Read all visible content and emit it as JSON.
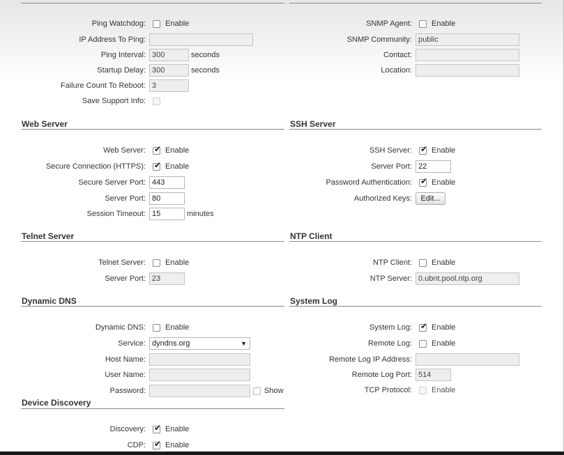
{
  "watchdog": {
    "ping_watchdog_label": "Ping Watchdog:",
    "enable": "Enable",
    "ip_label": "IP Address To Ping:",
    "ip_value": "",
    "interval_label": "Ping Interval:",
    "interval_value": "300",
    "interval_unit": "seconds",
    "startup_label": "Startup Delay:",
    "startup_value": "300",
    "startup_unit": "seconds",
    "failure_label": "Failure Count To Reboot:",
    "failure_value": "3",
    "support_label": "Save Support Info:"
  },
  "snmp": {
    "agent_label": "SNMP Agent:",
    "enable": "Enable",
    "community_label": "SNMP Community:",
    "community_value": "public",
    "contact_label": "Contact:",
    "contact_value": "",
    "location_label": "Location:",
    "location_value": ""
  },
  "web_server": {
    "title": "Web Server",
    "web_label": "Web Server:",
    "web_checked": true,
    "enable": "Enable",
    "https_label": "Secure Connection (HTTPS):",
    "https_checked": true,
    "secure_port_label": "Secure Server Port:",
    "secure_port_value": "443",
    "port_label": "Server Port:",
    "port_value": "80",
    "timeout_label": "Session Timeout:",
    "timeout_value": "15",
    "timeout_unit": "minutes"
  },
  "ssh_server": {
    "title": "SSH Server",
    "ssh_label": "SSH Server:",
    "ssh_checked": true,
    "enable": "Enable",
    "port_label": "Server Port:",
    "port_value": "22",
    "password_label": "Password Authentication:",
    "password_checked": true,
    "keys_label": "Authorized Keys:",
    "edit_button": "Edit..."
  },
  "telnet_server": {
    "title": "Telnet Server",
    "telnet_label": "Telnet Server:",
    "telnet_checked": false,
    "enable": "Enable",
    "port_label": "Server Port:",
    "port_value": "23"
  },
  "ntp_client": {
    "title": "NTP Client",
    "ntp_label": "NTP Client:",
    "ntp_checked": false,
    "enable": "Enable",
    "server_label": "NTP Server:",
    "server_value": "0.ubnt.pool.ntp.org"
  },
  "dynamic_dns": {
    "title": "Dynamic DNS",
    "ddns_label": "Dynamic DNS:",
    "ddns_checked": false,
    "enable": "Enable",
    "service_label": "Service:",
    "service_value": "dyndns.org",
    "host_label": "Host Name:",
    "host_value": "",
    "user_label": "User Name:",
    "user_value": "",
    "password_label": "Password:",
    "password_value": "",
    "show_label": "Show"
  },
  "system_log": {
    "title": "System Log",
    "syslog_label": "System Log:",
    "syslog_checked": true,
    "enable": "Enable",
    "remote_label": "Remote Log:",
    "remote_checked": false,
    "remote_ip_label": "Remote Log IP Address:",
    "remote_ip_value": "",
    "remote_port_label": "Remote Log Port:",
    "remote_port_value": "514",
    "tcp_label": "TCP Protocol:"
  },
  "device_discovery": {
    "title": "Device Discovery",
    "discovery_label": "Discovery:",
    "discovery_checked": true,
    "enable": "Enable",
    "cdp_label": "CDP:",
    "cdp_checked": true
  }
}
